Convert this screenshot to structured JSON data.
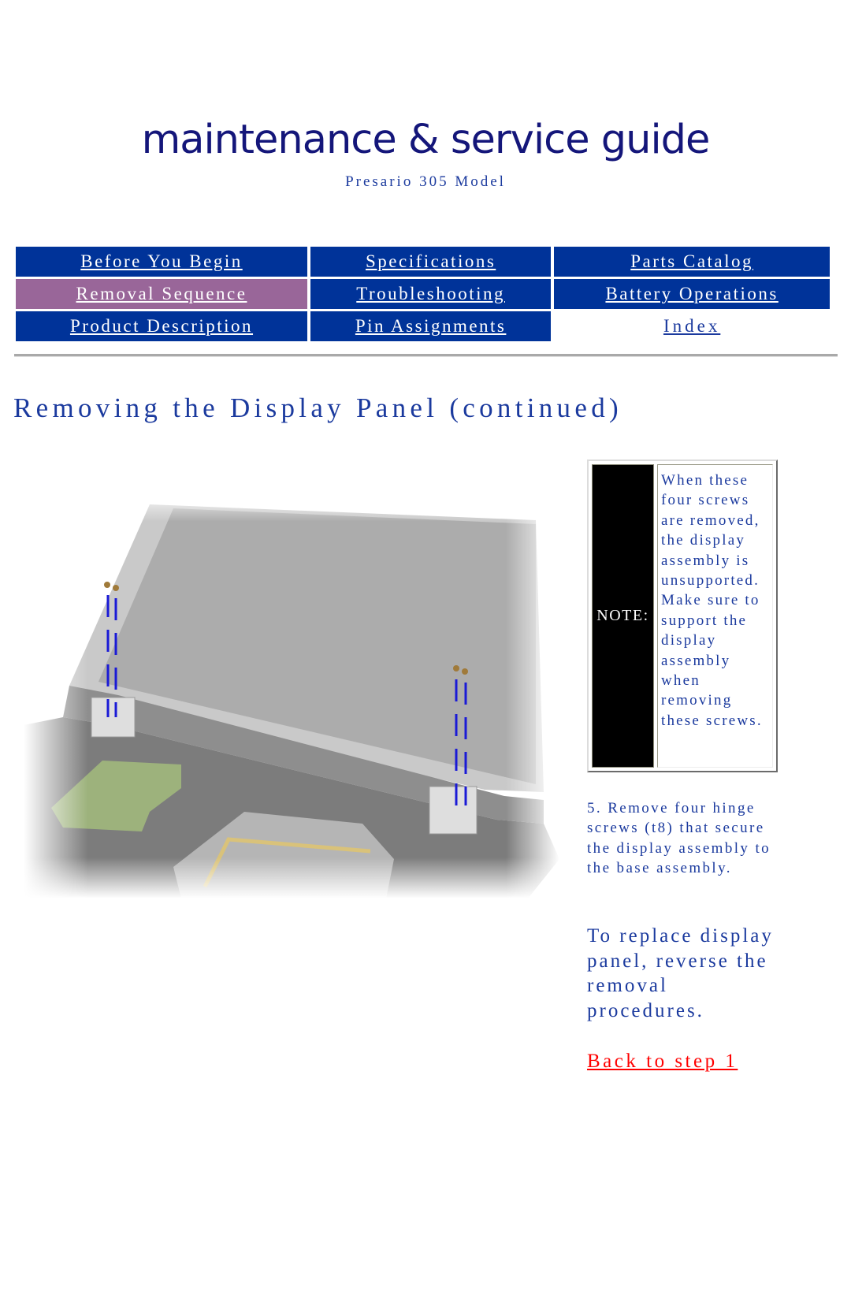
{
  "header": {
    "logo_text": "maintenance & service guide",
    "model": "Presario 305 Model"
  },
  "nav": {
    "rows": [
      [
        {
          "label": "Before You Begin",
          "state": "normal"
        },
        {
          "label": "Specifications",
          "state": "normal"
        },
        {
          "label": "Parts Catalog",
          "state": "normal"
        }
      ],
      [
        {
          "label": "Removal Sequence",
          "state": "active"
        },
        {
          "label": "Troubleshooting",
          "state": "normal"
        },
        {
          "label": "Battery Operations",
          "state": "normal"
        }
      ],
      [
        {
          "label": "Product Description",
          "state": "normal"
        },
        {
          "label": "Pin Assignments",
          "state": "normal"
        },
        {
          "label": "Index",
          "state": "plain"
        }
      ]
    ],
    "colors": {
      "normal": "#003399",
      "active": "#996699"
    }
  },
  "page": {
    "title": "Removing the Display Panel (continued)",
    "illustration": {
      "subject": "laptop display assembly with four hinge screws",
      "screw_count": 4
    },
    "note": {
      "label": "NOTE:",
      "text": "When these four screws are removed, the display assembly is unsupported. Make sure to support the display assembly when removing these screws."
    },
    "step": "5. Remove four hinge screws (t8) that secure the display assembly to the base assembly.",
    "replace_text": "To replace display panel, reverse the removal procedures.",
    "back_link": "Back to step 1"
  }
}
